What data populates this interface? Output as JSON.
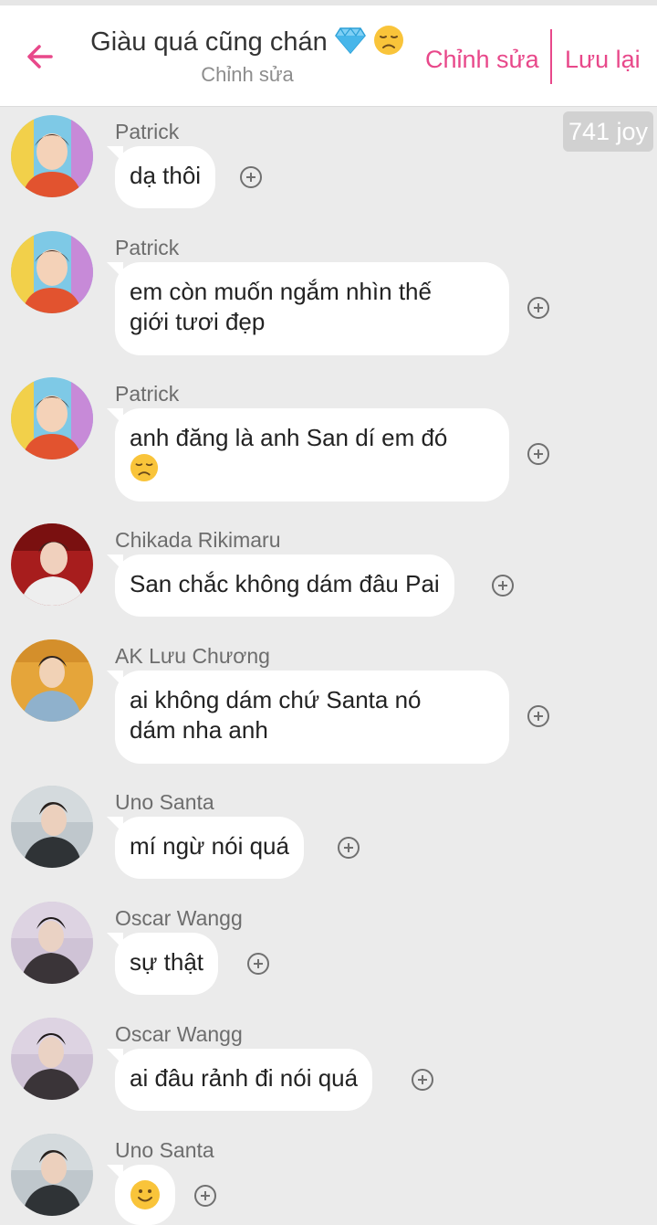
{
  "header": {
    "title": "Giàu quá cũng chán",
    "subtitle": "Chỉnh sửa",
    "edit_label": "Chỉnh sửa",
    "save_label": "Lưu lại",
    "accent_color": "#e8488a"
  },
  "joy_badge": "741 joy",
  "messages": [
    {
      "sender": "Patrick",
      "text": "dạ thôi"
    },
    {
      "sender": "Patrick",
      "line1": "em còn muốn ngắm nhìn thế",
      "line2": "giới tươi đẹp"
    },
    {
      "sender": "Patrick",
      "line1": "anh đăng là anh San dí em đó"
    },
    {
      "sender": "Chikada Rikimaru",
      "text": "San chắc không dám đâu Pai"
    },
    {
      "sender": "AK Lưu Chương",
      "line1": "ai không dám chứ Santa nó",
      "line2": "dám nha anh"
    },
    {
      "sender": "Uno Santa",
      "text": "mí ngừ nói quá"
    },
    {
      "sender": "Oscar Wangg",
      "text": "sự thật"
    },
    {
      "sender": "Oscar Wangg",
      "text": "ai đâu rảnh đi nói quá"
    },
    {
      "sender": "Uno Santa"
    }
  ]
}
